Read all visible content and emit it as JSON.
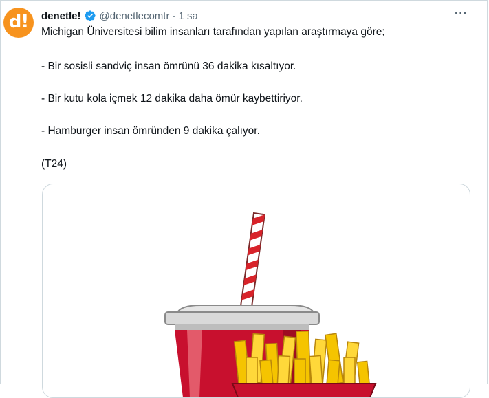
{
  "tweet": {
    "avatar_text": "d!",
    "display_name": "denetle!",
    "handle": "@denetlecomtr",
    "separator": "·",
    "time": "1 sa",
    "more_label": "···",
    "lines": [
      "Michigan Üniversitesi bilim insanları tarafından yapılan araştırmaya göre;",
      "- Bir sosisli sandviç insan ömrünü 36 dakika kısaltıyor.",
      "- Bir kutu kola içmek 12 dakika daha ömür kaybettiriyor.",
      "- Hamburger insan ömründen 9 dakika çalıyor.",
      "(T24)"
    ]
  },
  "colors": {
    "brand": "#f7931e",
    "verified": "#1d9bf0",
    "cup_red": "#c8102e",
    "fries": "#f5c400"
  },
  "icons": [
    "verified-badge-icon",
    "more-options-icon"
  ]
}
